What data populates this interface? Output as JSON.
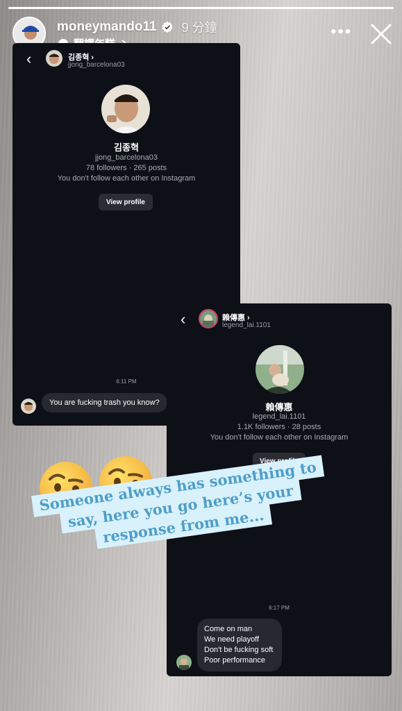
{
  "story": {
    "username": "moneymando11",
    "time": "9 分鐘",
    "translate": "翻譯年糕",
    "progress": 1.0
  },
  "dm1": {
    "header_name": "김종혁",
    "header_user": "jjong_barcelona03",
    "profile_name": "김종혁",
    "profile_user": "jjong_barcelona03",
    "stats": "78 followers · 265 posts",
    "follow_note": "You don't follow each other on Instagram",
    "view_profile": "View profile",
    "timestamp": "6:11 PM",
    "message": "You are fucking trash you know?"
  },
  "dm2": {
    "header_name": "賴傳惠",
    "header_user": "legend_lai.1101",
    "profile_name": "賴傳惠",
    "profile_user": "legend_lai.1101",
    "stats": "1.1K followers · 28 posts",
    "follow_note": "You don't follow each other on Instagram",
    "view_profile": "View profile",
    "timestamp": "6:17 PM",
    "message_lines": [
      "Come on man",
      "We need playoff",
      "Don't be fucking soft",
      "Poor performance"
    ]
  },
  "caption": {
    "lines": [
      "Someone always has something to",
      "say, here you go here’s your",
      "response from me..."
    ]
  },
  "colors": {
    "card_bg": "#0d1016",
    "bubble_bg": "#26292f",
    "caption_bg": "#d9f1fb",
    "caption_text": "#4d9ec9",
    "verified": "#3897f0"
  },
  "icons": [
    "verified-icon",
    "more-icon",
    "close-icon",
    "back-icon",
    "raised-eyebrow-emoji-icon"
  ]
}
